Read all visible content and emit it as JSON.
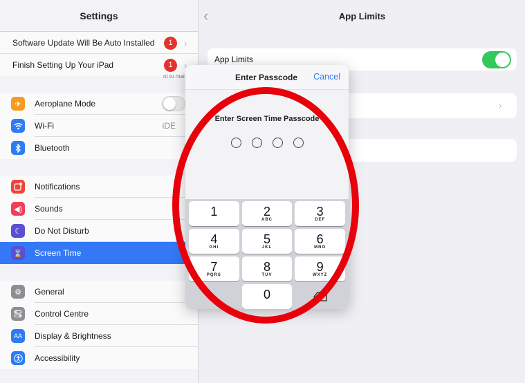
{
  "sidebar": {
    "title": "Settings",
    "top_items": [
      {
        "label": "Software Update Will Be Auto Installed",
        "badge": "1"
      },
      {
        "label": "Finish Setting Up Your iPad",
        "badge": "1"
      }
    ],
    "network": [
      {
        "label": "Aeroplane Mode",
        "icon": "airplane-icon",
        "color": "#f59b21"
      },
      {
        "label": "Wi-Fi",
        "icon": "wifi-icon",
        "color": "#2f7bf5",
        "value": "iDE"
      },
      {
        "label": "Bluetooth",
        "icon": "bluetooth-icon",
        "color": "#2f7bf5"
      }
    ],
    "alerts": [
      {
        "label": "Notifications",
        "icon": "notifications-icon",
        "color": "#f0453a"
      },
      {
        "label": "Sounds",
        "icon": "speaker-icon",
        "color": "#f13d5a"
      },
      {
        "label": "Do Not Disturb",
        "icon": "moon-icon",
        "color": "#5b4fd3"
      },
      {
        "label": "Screen Time",
        "icon": "hourglass-icon",
        "color": "#5b4fd3"
      }
    ],
    "general": [
      {
        "label": "General",
        "icon": "gear-icon",
        "color": "#8e8e93"
      },
      {
        "label": "Control Centre",
        "icon": "control-centre-icon",
        "color": "#8e8e93"
      },
      {
        "label": "Display & Brightness",
        "icon": "aa-icon",
        "color": "#2f7bf5",
        "glyph": "AA"
      },
      {
        "label": "Accessibility",
        "icon": "accessibility-icon",
        "color": "#2f7bf5"
      }
    ]
  },
  "main": {
    "title": "App Limits",
    "limits_label": "App Limits",
    "footnote": "nt to manage. Limits reset every day at midnight."
  },
  "passcode": {
    "title": "Enter Passcode",
    "cancel": "Cancel",
    "prompt": "Enter Screen Time Passcode",
    "keys": [
      {
        "num": "1",
        "letters": ""
      },
      {
        "num": "2",
        "letters": "ABC"
      },
      {
        "num": "3",
        "letters": "DEF"
      },
      {
        "num": "4",
        "letters": "GHI"
      },
      {
        "num": "5",
        "letters": "JKL"
      },
      {
        "num": "6",
        "letters": "MNO"
      },
      {
        "num": "7",
        "letters": "PQRS"
      },
      {
        "num": "8",
        "letters": "TUV"
      },
      {
        "num": "9",
        "letters": "WXYZ"
      },
      {
        "num": "0",
        "letters": ""
      }
    ]
  },
  "colors": {
    "accent": "#2f7bf5",
    "selected": "#3478f6",
    "toggle_on": "#34c759",
    "badge": "#e5322d",
    "annotation": "#e8000b"
  }
}
